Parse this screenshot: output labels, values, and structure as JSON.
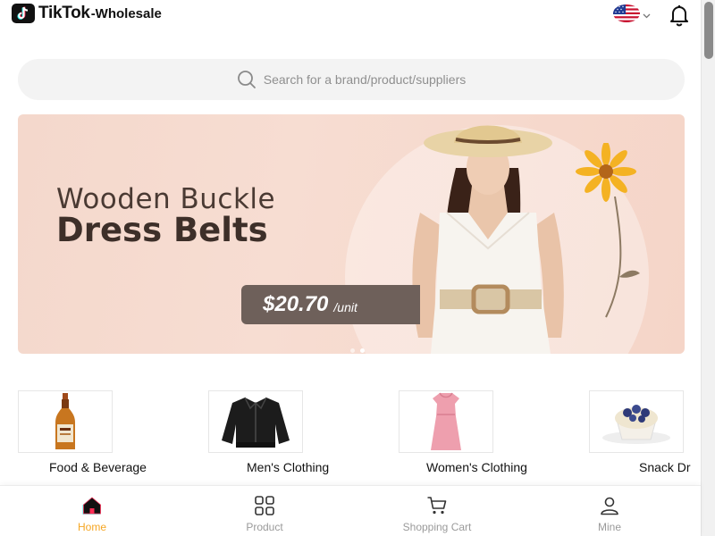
{
  "header": {
    "brand": "TikTok",
    "suffix": "-Wholesale",
    "icons": [
      "tiktok-logo-icon",
      "us-flag-icon",
      "chevron-down-icon",
      "bell-icon"
    ]
  },
  "search": {
    "placeholder": "Search for a brand/product/suppliers"
  },
  "banner": {
    "title_line1": "Wooden Buckle",
    "title_line2": "Dress Belts",
    "price": "$20.70",
    "unit": "/unit",
    "dots": 2,
    "active_dot": 2
  },
  "categories": [
    {
      "label": "Food & Beverage",
      "icon": "whiskey-bottle-image"
    },
    {
      "label": "Men's Clothing",
      "icon": "leather-jacket-image"
    },
    {
      "label": "Women's Clothing",
      "icon": "pink-dress-image"
    },
    {
      "label": "Snack Dr",
      "icon": "blueberry-cupcake-image"
    }
  ],
  "bottom_nav": [
    {
      "label": "Home",
      "icon": "home-icon",
      "active": true
    },
    {
      "label": "Product",
      "icon": "grid-icon",
      "active": false
    },
    {
      "label": "Shopping Cart",
      "icon": "cart-icon",
      "active": false
    },
    {
      "label": "Mine",
      "icon": "user-icon",
      "active": false
    }
  ],
  "colors": {
    "accent": "#f5a623",
    "banner_bg": "#f6d8cc",
    "search_bg": "#f3f3f3"
  }
}
